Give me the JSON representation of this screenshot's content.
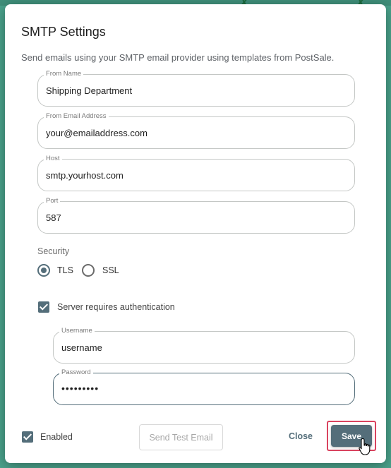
{
  "dialog": {
    "title": "SMTP Settings",
    "subtitle": "Send emails using your SMTP email provider using templates from PostSale."
  },
  "fields": {
    "from_name": {
      "label": "From Name",
      "value": "Shipping Department"
    },
    "from_email": {
      "label": "From Email Address",
      "value": "your@emailaddress.com"
    },
    "host": {
      "label": "Host",
      "value": "smtp.yourhost.com"
    },
    "port": {
      "label": "Port",
      "value": "587"
    },
    "username": {
      "label": "Username",
      "value": "username"
    },
    "password": {
      "label": "Password",
      "value": "•••••••••"
    }
  },
  "security": {
    "label": "Security",
    "options": [
      "TLS",
      "SSL"
    ],
    "selected": "TLS"
  },
  "auth": {
    "label": "Server requires authentication",
    "checked": true
  },
  "footer": {
    "enabled_label": "Enabled",
    "enabled_checked": true,
    "send_test_label": "Send Test Email",
    "close_label": "Close",
    "save_label": "Save"
  },
  "colors": {
    "accent": "#546e7a",
    "highlight": "#d9435f",
    "backdrop": "#4aa38c"
  }
}
